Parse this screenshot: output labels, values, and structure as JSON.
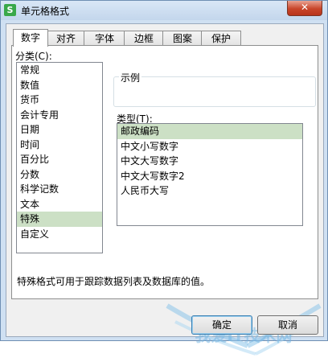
{
  "window": {
    "title": "单元格格式",
    "close_label": "✕"
  },
  "tabs": [
    {
      "label": "数字",
      "active": true
    },
    {
      "label": "对齐",
      "active": false
    },
    {
      "label": "字体",
      "active": false
    },
    {
      "label": "边框",
      "active": false
    },
    {
      "label": "图案",
      "active": false
    },
    {
      "label": "保护",
      "active": false
    }
  ],
  "category": {
    "label": "分类(C):",
    "items": [
      "常规",
      "数值",
      "货币",
      "会计专用",
      "日期",
      "时间",
      "百分比",
      "分数",
      "科学记数",
      "文本",
      "特殊",
      "自定义"
    ],
    "selected": "特殊"
  },
  "sample": {
    "label": "示例"
  },
  "type": {
    "label": "类型(T):",
    "items": [
      "邮政编码",
      "中文小写数字",
      "中文大写数字",
      "中文大写数字2",
      "人民币大写"
    ],
    "selected": "邮政编码"
  },
  "description": "特殊格式可用于跟踪数据列表及数据库的值。",
  "buttons": {
    "ok": "确定",
    "cancel": "取消"
  },
  "watermark": "我爱IT技术网",
  "colors": {
    "selection": "#cce0c5",
    "titlebar": "#c3d6ec",
    "close": "#c8452a"
  }
}
